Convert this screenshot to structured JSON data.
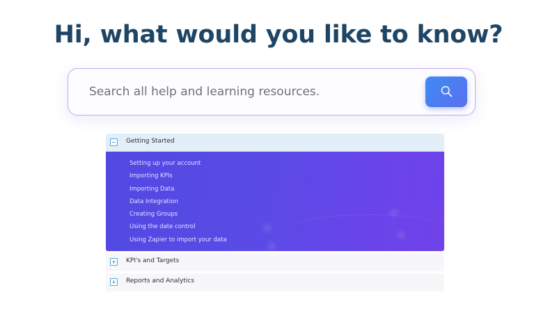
{
  "heading": "Hi, what would you like to know?",
  "search": {
    "placeholder": "Search all help and learning resources.",
    "value": "",
    "button_icon": "search-icon"
  },
  "accordion": {
    "sections": [
      {
        "title": "Getting Started",
        "expanded": true,
        "toggle_icon": "minus-square-icon",
        "links": [
          "Setting up your account",
          "Importing KPIs",
          "Importing Data",
          "Data Integration",
          "Creating Groups",
          "Using the date control",
          "Using Zapier to import your data"
        ]
      },
      {
        "title": "KPI's and Targets",
        "expanded": false,
        "toggle_icon": "plus-square-icon"
      },
      {
        "title": "Reports and Analytics",
        "expanded": false,
        "toggle_icon": "plus-square-icon"
      }
    ]
  },
  "colors": {
    "heading": "#1f4565",
    "search_border": "#b9acf0",
    "search_button": "#4a7cf1",
    "panel_background": "#5a4be6",
    "open_header": "#e2eef8",
    "toggle_icon": "#55a9d8"
  }
}
